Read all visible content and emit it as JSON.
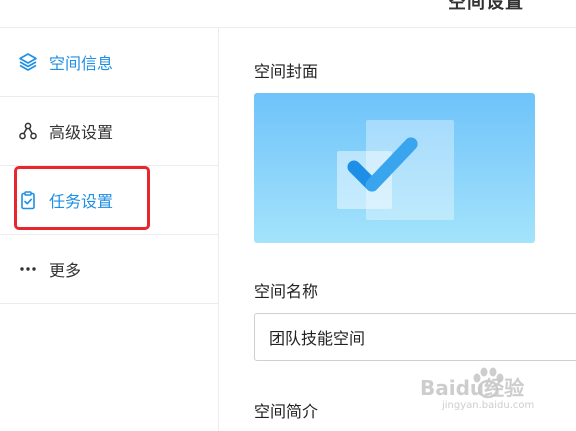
{
  "header": {
    "title": "空间设置"
  },
  "sidebar": {
    "items": [
      {
        "label": "空间信息",
        "icon": "layers-icon"
      },
      {
        "label": "高级设置",
        "icon": "network-nodes-icon"
      },
      {
        "label": "任务设置",
        "icon": "clipboard-check-icon"
      },
      {
        "label": "更多",
        "icon": "more-dots-icon"
      }
    ]
  },
  "main": {
    "cover_label": "空间封面",
    "name_label": "空间名称",
    "name_value": "团队技能空间",
    "intro_label": "空间简介"
  },
  "watermark": {
    "brand": "Baidu经验",
    "url": "jingyan.baidu.com"
  },
  "colors": {
    "accent": "#1e8fe6",
    "highlight": "#e8262b",
    "cover_gradient_top": "#6ec3fa",
    "cover_gradient_bottom": "#a3e4fb"
  }
}
